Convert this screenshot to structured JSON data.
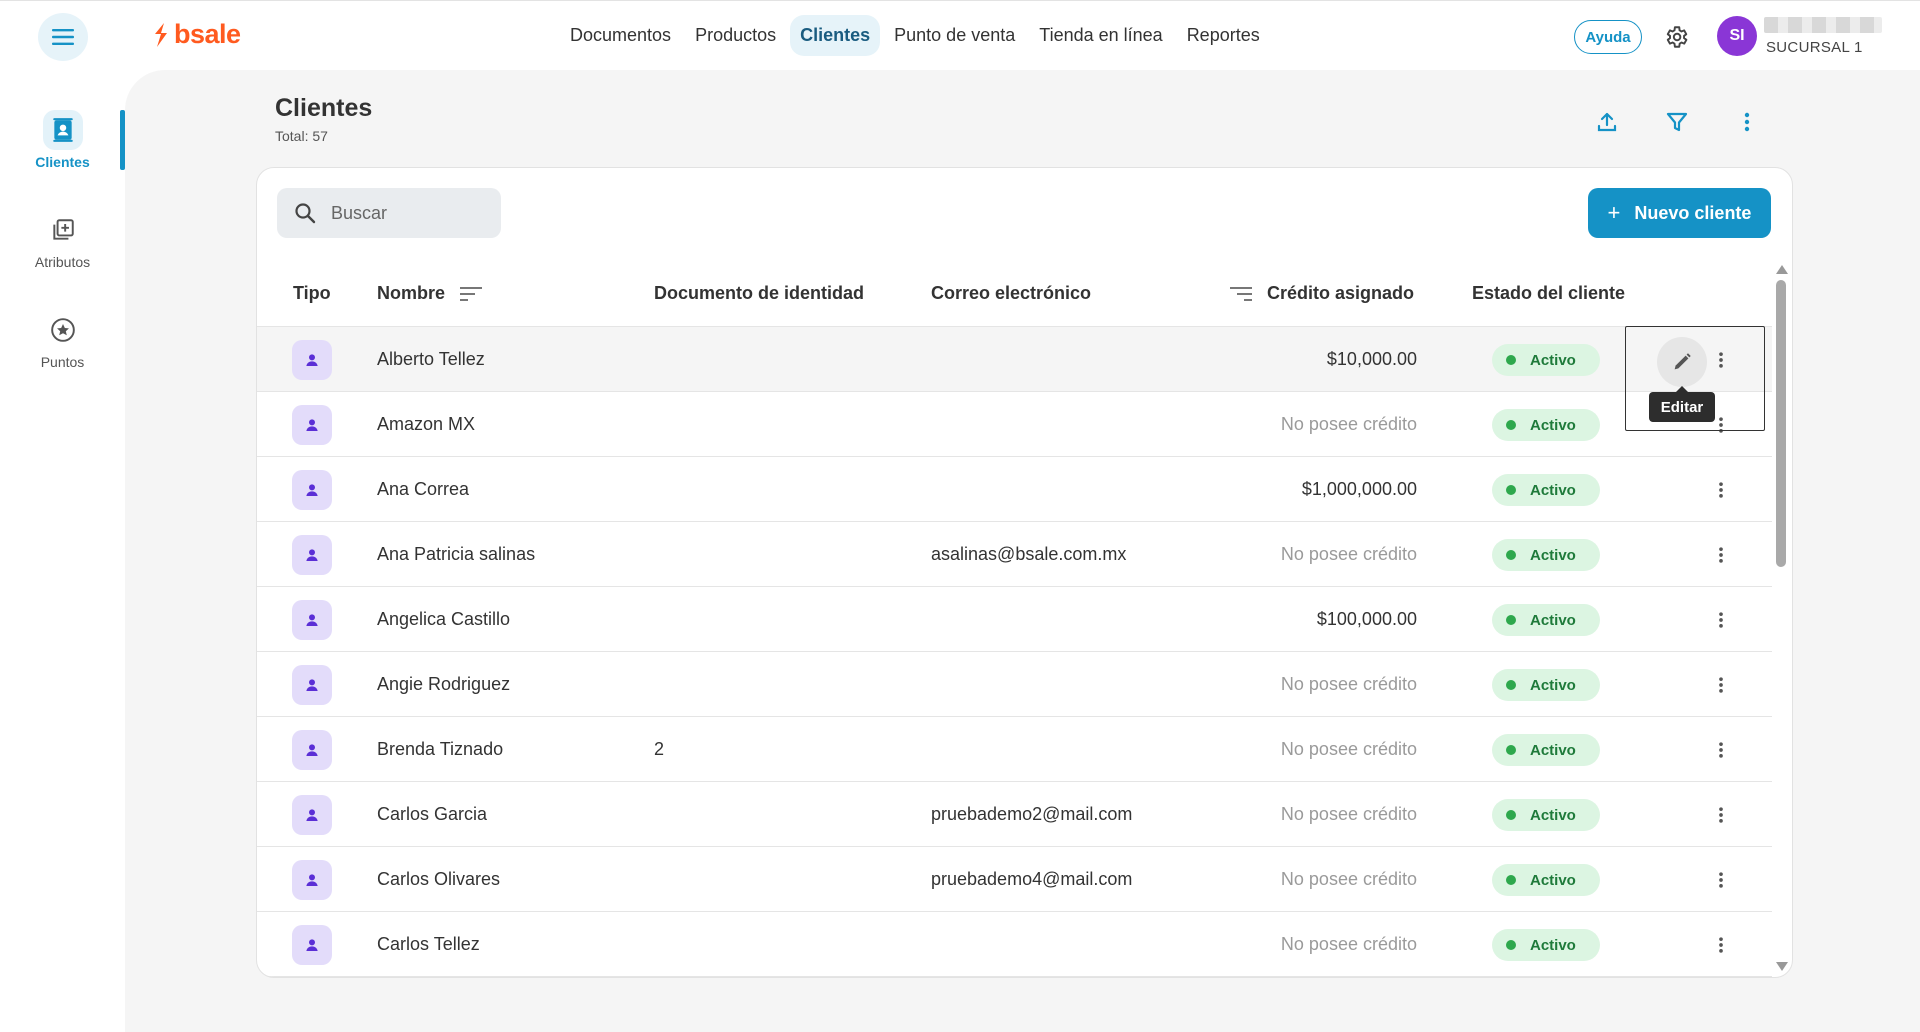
{
  "app": {
    "brand": "bsale"
  },
  "nav": [
    {
      "label": "Documentos",
      "active": false
    },
    {
      "label": "Productos",
      "active": false
    },
    {
      "label": "Clientes",
      "active": true
    },
    {
      "label": "Punto de venta",
      "active": false
    },
    {
      "label": "Tienda en línea",
      "active": false
    },
    {
      "label": "Reportes",
      "active": false
    }
  ],
  "topbar": {
    "help_label": "Ayuda",
    "avatar_initials": "SI",
    "branch": "SUCURSAL 1"
  },
  "sidebar": {
    "items": [
      {
        "label": "Clientes",
        "icon": "contacts-icon",
        "active": true
      },
      {
        "label": "Atributos",
        "icon": "library-add-icon",
        "active": false
      },
      {
        "label": "Puntos",
        "icon": "star-circle-icon",
        "active": false
      }
    ]
  },
  "page": {
    "title": "Clientes",
    "total": "Total: 57"
  },
  "search": {
    "placeholder": "Buscar"
  },
  "actions": {
    "new_client": "Nuevo cliente"
  },
  "table": {
    "headers": {
      "type": "Tipo",
      "name": "Nombre",
      "document": "Documento de identidad",
      "email": "Correo electrónico",
      "credit": "Crédito asignado",
      "status": "Estado del cliente"
    },
    "rows": [
      {
        "name": "Alberto Tellez",
        "document": "",
        "email": "",
        "credit": "$10,000.00",
        "status": "Activo"
      },
      {
        "name": "Amazon MX",
        "document": "",
        "email": "",
        "credit": "No posee crédito",
        "status": "Activo"
      },
      {
        "name": "Ana Correa",
        "document": "",
        "email": "",
        "credit": "$1,000,000.00",
        "status": "Activo"
      },
      {
        "name": "Ana Patricia salinas",
        "document": "",
        "email": "asalinas@bsale.com.mx",
        "credit": "No posee crédito",
        "status": "Activo"
      },
      {
        "name": "Angelica Castillo",
        "document": "",
        "email": "",
        "credit": "$100,000.00",
        "status": "Activo"
      },
      {
        "name": "Angie Rodriguez",
        "document": "",
        "email": "",
        "credit": "No posee crédito",
        "status": "Activo"
      },
      {
        "name": "Brenda Tiznado",
        "document": "2",
        "email": "",
        "credit": "No posee crédito",
        "status": "Activo"
      },
      {
        "name": "Carlos Garcia",
        "document": "",
        "email": "pruebademo2@mail.com",
        "credit": "No posee crédito",
        "status": "Activo"
      },
      {
        "name": "Carlos Olivares",
        "document": "",
        "email": "pruebademo4@mail.com",
        "credit": "No posee crédito",
        "status": "Activo"
      },
      {
        "name": "Carlos Tellez",
        "document": "",
        "email": "",
        "credit": "No posee crédito",
        "status": "Activo"
      }
    ]
  },
  "tooltip": {
    "edit": "Editar"
  },
  "colors": {
    "brand": "#ff5a1f",
    "accent": "#1592c6",
    "avatar": "#8a36d6",
    "status_bg": "#dcf5e2",
    "status_dot": "#2ea84d"
  }
}
